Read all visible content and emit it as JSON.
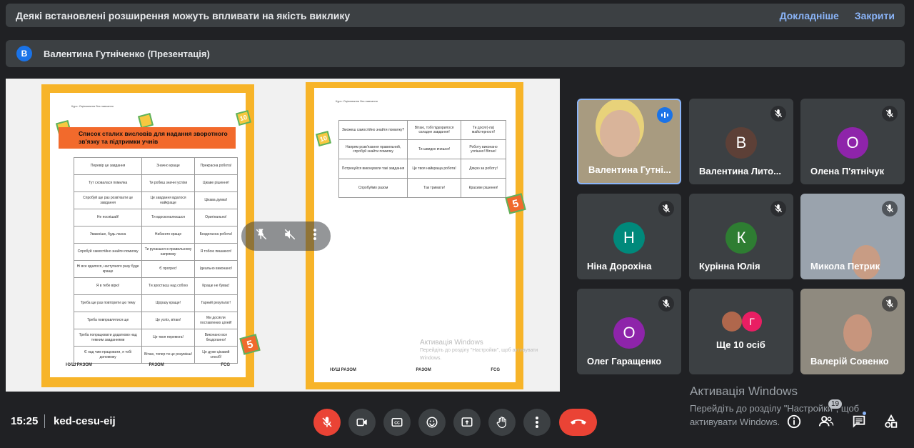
{
  "banner": {
    "message": "Деякі встановлені розширення можуть впливати на якість виклику",
    "details": "Докладніше",
    "close": "Закрити"
  },
  "presenter": {
    "initial": "В",
    "label": "Валентина Гутніченко (Презентація)"
  },
  "document": {
    "header": "Курс: Оцінювання без навчання",
    "title": "Список сталих висловів для надання зворотного зв'язку та підтримки учнів",
    "table1": [
      [
        "Перевір це завдання",
        "Значно краще",
        "Прекрасна робота!"
      ],
      [
        "Тут сховалася помилка",
        "Ти робиш значні успіхи",
        "Цікаве рішення!"
      ],
      [
        "Спробуй ще раз розв'язати це завдання",
        "Це завдання вдалося найкраще",
        "Цікава думка!"
      ],
      [
        "Не поспішай!",
        "Ти вдосконалюєшся",
        "Оригінально!"
      ],
      [
        "Уважніше, будь ласка",
        "Набагато краще",
        "Бездоганна робота!"
      ],
      [
        "Спробуй самостійно знайти помилку",
        "Ти рухаєшся в правильному напрямку",
        "Я тобою пишаюся!"
      ],
      [
        "Ні все вдалося, наступного разу буде краще",
        "Є прогрес!",
        "Ідеально виконано!"
      ],
      [
        "Я в тебе вірю!",
        "Ти зростаєш над собою",
        "Краще не буває!"
      ],
      [
        "Треба ще раз повторити цю тему",
        "Щоразу краще!",
        "Гарний результат!"
      ],
      [
        "Треба повправлятися ще",
        "Це успіх, вітаю!",
        "Ми досягли поставлених цілей!"
      ],
      [
        "Треба попрацювати додатково над темним завданнями",
        "Це твоя перемога!",
        "Виконано все бездоганно!"
      ],
      [
        "Є над чим працювати, я тобі допоможу",
        "Вітаю, тепер ти це розумієш!",
        "Це дуже цікавий спосіб!"
      ]
    ],
    "table2": [
      [
        "Зможеш самостійно знайти помилку?",
        "Вітаю, тобі підкорилося складне завдання!",
        "Ти досяг(-ла) майстерності!"
      ],
      [
        "Напрям розв'язання правильний, спробуй знайти помилку",
        "Ти швидко вчишся!",
        "Роботу виконано успішно! Вітаю!"
      ],
      [
        "Потренуйся виконувати такі завдання",
        "Це твоя найкраща робота!",
        "Дякую за роботу!"
      ],
      [
        "Спробуймо разом",
        "Так тримати!",
        "Красиве рішення!"
      ]
    ],
    "sticker_a": "10",
    "sticker_b": "5",
    "logos": [
      "НУШ РАЗОМ",
      "РАЗОМ",
      "FCG"
    ],
    "watermark_title": "Активація Windows",
    "watermark_sub": "Перейдіть до розділу \"Настройки\", щоб активувати Windows."
  },
  "participants": [
    {
      "name": "Валентина Гутні...",
      "initial": "",
      "color": "",
      "video": true,
      "speaking": true
    },
    {
      "name": "Валентина Лито...",
      "initial": "В",
      "color": "#5d4037",
      "muted": true
    },
    {
      "name": "Олена П'ятнічук",
      "initial": "О",
      "color": "#8e24aa",
      "muted": true
    },
    {
      "name": "Ніна Дорохіна",
      "initial": "Н",
      "color": "#00897b",
      "muted": true
    },
    {
      "name": "Курінна Юлія",
      "initial": "К",
      "color": "#2e7d32",
      "muted": true
    },
    {
      "name": "Микола Петрик",
      "initial": "",
      "video": true,
      "muted": true
    },
    {
      "name": "Олег Гаращенко",
      "initial": "О",
      "color": "#8e24aa",
      "muted": true
    },
    {
      "name": "Ще 10 осіб",
      "initial": "Г",
      "color": "#e91e63"
    },
    {
      "name": "Валерій Совенко",
      "initial": "",
      "video": true,
      "muted": true
    }
  ],
  "windows_activation": {
    "title": "Активація Windows",
    "line1": "Перейдіть до розділу \"Настройки\", щоб",
    "line2": "активувати Windows."
  },
  "footer": {
    "time": "15:25",
    "meeting_code": "ked-cesu-eij",
    "people_count": "19"
  },
  "colors": {
    "bg": "#202124",
    "surface": "#3c4043",
    "accent": "#8ab4f8",
    "danger": "#ea4335"
  }
}
